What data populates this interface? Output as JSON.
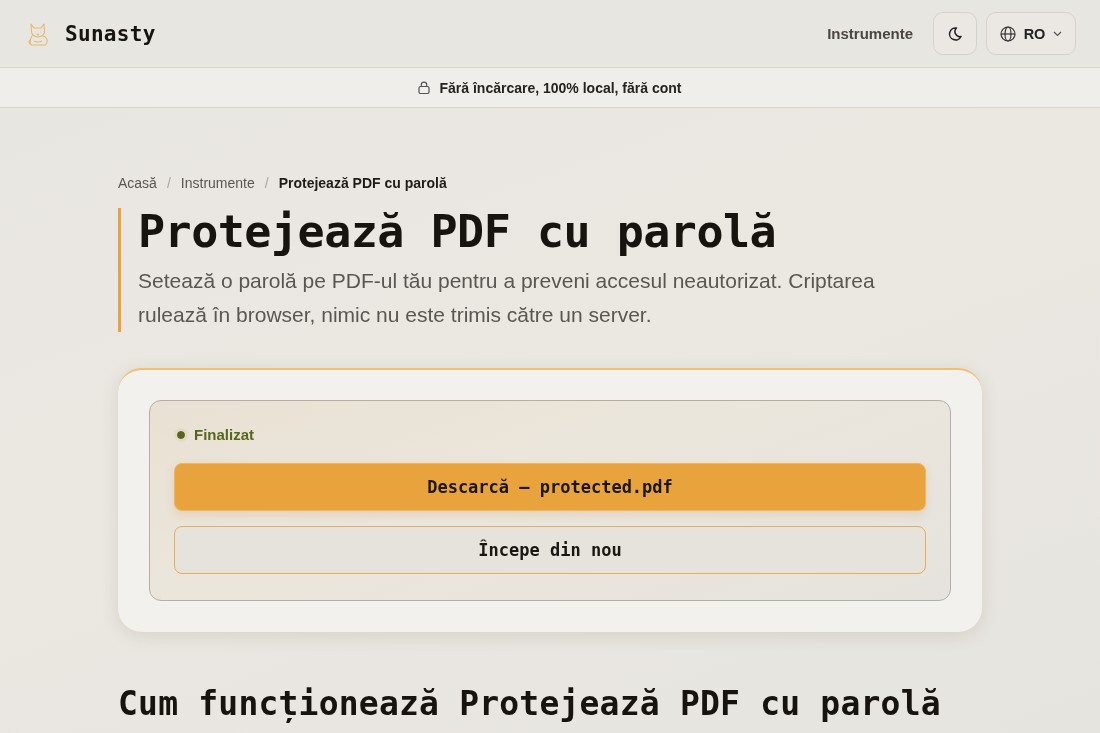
{
  "header": {
    "brand": "Sunasty",
    "nav": [
      {
        "label": "Instrumente"
      }
    ],
    "language": "RO"
  },
  "banner": {
    "text": "Fără încărcare, 100% local, fără cont"
  },
  "breadcrumb": {
    "separator": "/",
    "items": [
      {
        "label": "Acasă",
        "current": false
      },
      {
        "label": "Instrumente",
        "current": false
      },
      {
        "label": "Protejează PDF cu parolă",
        "current": true
      }
    ]
  },
  "title": "Protejează PDF cu parolă",
  "description": "Setează o parolă pe PDF-ul tău pentru a preveni accesul neautorizat. Criptarea rulează în browser, nimic nu este trimis către un server.",
  "result": {
    "status": {
      "label": "Finalizat",
      "kind": "success"
    },
    "buttons": [
      {
        "label": "Descarcă — protected.pdf",
        "kind": "primary"
      },
      {
        "label": "Începe din nou",
        "kind": "secondary"
      }
    ]
  },
  "section_heading": "Cum funcționează Protejează PDF cu parolă"
}
